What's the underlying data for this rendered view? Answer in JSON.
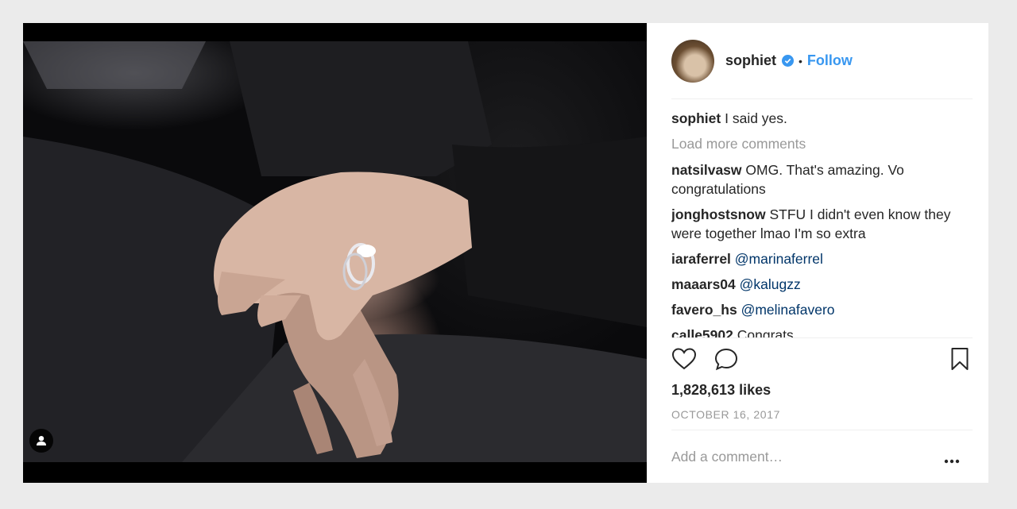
{
  "post": {
    "author": {
      "username": "sophiet",
      "verified": true,
      "follow_label": "Follow",
      "separator": "•"
    },
    "caption": {
      "username": "sophiet",
      "text": "I said yes."
    },
    "load_more_label": "Load more comments",
    "comments": [
      {
        "username": "natsilvasw",
        "text": "OMG. That's amazing. Vo congratulations"
      },
      {
        "username": "jonghostsnow",
        "text": "STFU I didn't even know they were together lmao I'm so extra"
      },
      {
        "username": "iaraferrel",
        "mention": "@marinaferrel"
      },
      {
        "username": "maaars04",
        "mention": "@kalugzz"
      },
      {
        "username": "favero_hs",
        "mention": "@melinafavero"
      },
      {
        "username": "calle5902",
        "text": "Congrats"
      }
    ],
    "likes_text": "1,828,613 likes",
    "date_text": "OCTOBER 16, 2017",
    "add_comment_placeholder": "Add a comment…",
    "icons": {
      "like": "heart-icon",
      "comment": "comment-bubble-icon",
      "save": "bookmark-icon",
      "more": "ellipsis-icon",
      "tagged": "person-tag-icon",
      "verified": "verified-badge-icon"
    },
    "colors": {
      "link": "#3897f0",
      "mention": "#003569",
      "muted": "#999999",
      "text": "#262626",
      "page_bg": "#ebebeb"
    }
  }
}
